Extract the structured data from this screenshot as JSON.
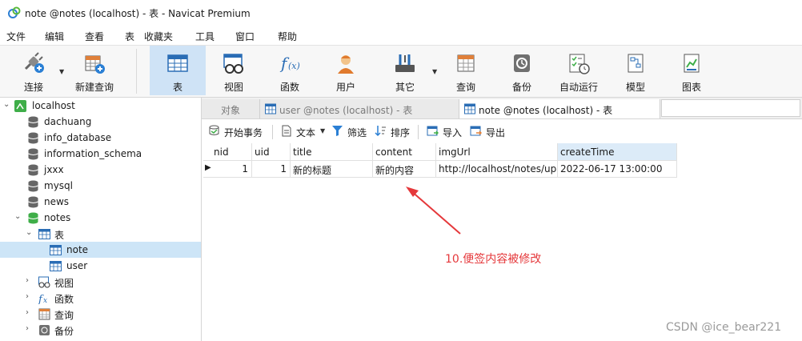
{
  "window": {
    "title": "note @notes (localhost) - 表 - Navicat Premium"
  },
  "menu": [
    "文件",
    "编辑",
    "查看",
    "表",
    "收藏夹",
    "工具",
    "窗口",
    "帮助"
  ],
  "toolbar": [
    {
      "label": "连接",
      "icon": "connection-plug-icon"
    },
    {
      "label": "新建查询",
      "icon": "new-query-icon"
    },
    {
      "label": "表",
      "icon": "table-icon",
      "active": true
    },
    {
      "label": "视图",
      "icon": "view-icon"
    },
    {
      "label": "函数",
      "icon": "function-icon"
    },
    {
      "label": "用户",
      "icon": "user-icon"
    },
    {
      "label": "其它",
      "icon": "tools-icon"
    },
    {
      "label": "查询",
      "icon": "query-icon"
    },
    {
      "label": "备份",
      "icon": "backup-icon"
    },
    {
      "label": "自动运行",
      "icon": "schedule-icon"
    },
    {
      "label": "模型",
      "icon": "model-icon"
    },
    {
      "label": "图表",
      "icon": "chart-icon"
    }
  ],
  "tree": {
    "connection": "localhost",
    "databases": [
      "dachuang",
      "info_database",
      "information_schema",
      "jxxx",
      "mysql",
      "news"
    ],
    "open_db": "notes",
    "tables_group": "表",
    "tables": [
      "note",
      "user"
    ],
    "other_groups": [
      "视图",
      "函数",
      "查询",
      "备份"
    ]
  },
  "tabs": [
    "对象",
    "user @notes (localhost) - 表",
    "note @notes (localhost) - 表"
  ],
  "object_toolbar": [
    "开始事务",
    "文本",
    "筛选",
    "排序",
    "导入",
    "导出"
  ],
  "table": {
    "columns": [
      "nid",
      "uid",
      "title",
      "content",
      "imgUrl",
      "createTime"
    ],
    "rows": [
      {
        "nid": "1",
        "uid": "1",
        "title": "新的标题",
        "content": "新的内容",
        "imgUrl": "http://localhost/notes/upl",
        "createTime": "2022-06-17 13:00:00"
      }
    ]
  },
  "annotation": "10.便签内容被修改",
  "watermark": "CSDN @ice_bear221",
  "colors": {
    "accent": "#cfe3f6",
    "selection": "#cde5f7",
    "annotation": "#e5383b",
    "db_active": "#3fae49"
  }
}
